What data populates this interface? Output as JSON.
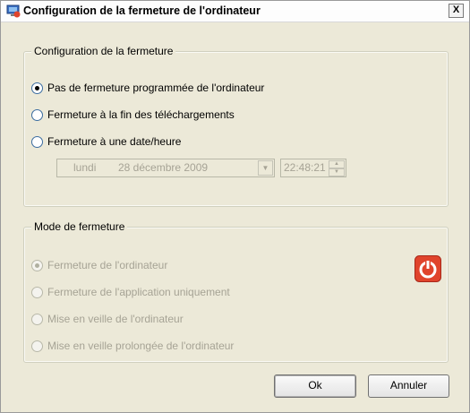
{
  "window": {
    "title": "Configuration de la fermeture de l'ordinateur",
    "close_label": "X"
  },
  "shutdown_config": {
    "title": "Configuration de la fermeture",
    "options": [
      {
        "label": "Pas de fermeture programmée de l'ordinateur",
        "checked": true
      },
      {
        "label": "Fermeture à la fin des téléchargements",
        "checked": false
      },
      {
        "label": "Fermeture à une date/heure",
        "checked": false
      }
    ],
    "date": {
      "day": "lundi",
      "date": "28 décembre 2009"
    },
    "time": "22:48:21"
  },
  "shutdown_mode": {
    "title": "Mode de fermeture",
    "options": [
      {
        "label": "Fermeture de l'ordinateur",
        "checked": true
      },
      {
        "label": "Fermeture de l'application uniquement",
        "checked": false
      },
      {
        "label": "Mise en veille de l'ordinateur",
        "checked": false
      },
      {
        "label": "Mise en veille prolongée de l'ordinateur",
        "checked": false
      }
    ]
  },
  "buttons": {
    "ok": "Ok",
    "cancel": "Annuler"
  },
  "colors": {
    "dialog_bg": "#ece9d8",
    "power_icon": "#e0442c",
    "disabled_text": "#a6a395"
  }
}
